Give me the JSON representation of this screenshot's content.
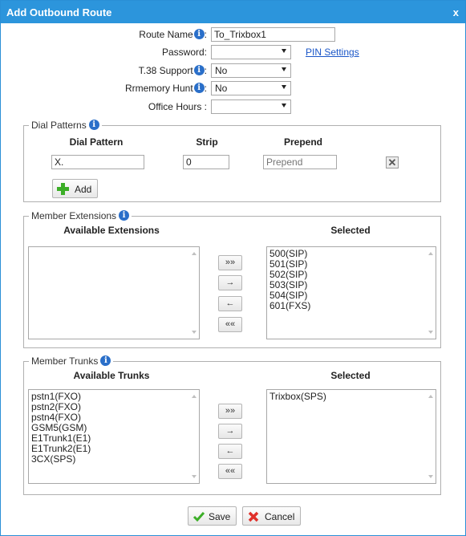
{
  "dialog": {
    "title": "Add Outbound Route",
    "close": "x"
  },
  "form": {
    "route_name_label": "Route Name",
    "route_name_value": "To_Trixbox1",
    "password_label": "Password:",
    "password_value": "",
    "pin_settings_link": "PIN Settings",
    "t38_label": "T.38 Support",
    "t38_value": "No",
    "rrmemory_label": "Rrmemory Hunt",
    "rrmemory_value": "No",
    "office_hours_label": "Office Hours :",
    "office_hours_value": ""
  },
  "dial_patterns": {
    "legend": "Dial Patterns",
    "col_pattern": "Dial Pattern",
    "col_strip": "Strip",
    "col_prepend": "Prepend",
    "pattern_value": "X.",
    "strip_value": "0",
    "prepend_placeholder": "Prepend",
    "add_label": "Add"
  },
  "member_extensions": {
    "legend": "Member Extensions",
    "available_header": "Available Extensions",
    "selected_header": "Selected",
    "available": [],
    "selected": [
      "500(SIP)",
      "501(SIP)",
      "502(SIP)",
      "503(SIP)",
      "504(SIP)",
      "601(FXS)"
    ]
  },
  "member_trunks": {
    "legend": "Member Trunks",
    "available_header": "Available Trunks",
    "selected_header": "Selected",
    "available": [
      "pstn1(FXO)",
      "pstn2(FXO)",
      "pstn4(FXO)",
      "GSM5(GSM)",
      "E1Trunk1(E1)",
      "E1Trunk2(E1)",
      "3CX(SPS)"
    ],
    "selected": [
      "Trixbox(SPS)"
    ]
  },
  "move_buttons": {
    "add_all": "»»",
    "add": "→",
    "remove": "←",
    "remove_all": "««"
  },
  "footer": {
    "save_label": "Save",
    "cancel_label": "Cancel"
  },
  "colors": {
    "titlebar": "#2c95dc",
    "link": "#1a56c8",
    "save_check": "#3cae27",
    "cancel_x": "#e0302a"
  }
}
